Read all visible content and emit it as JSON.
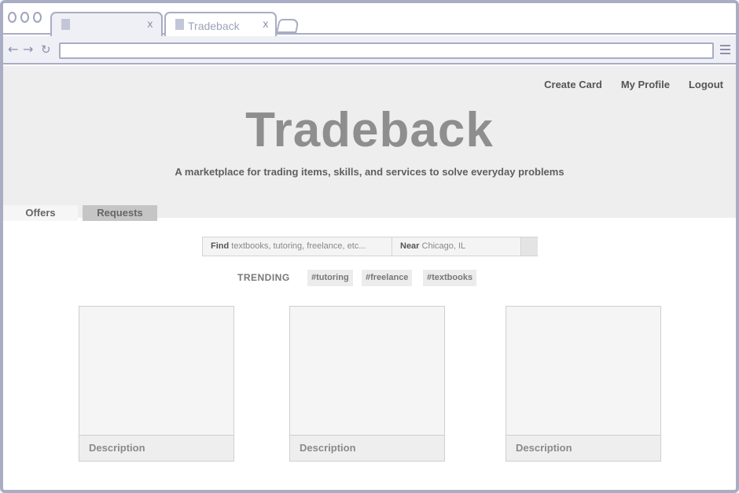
{
  "browser": {
    "tabs": [
      {
        "title": "",
        "close": "x"
      },
      {
        "title": "Tradeback",
        "close": "x"
      }
    ],
    "url": ""
  },
  "header": {
    "links": [
      "Create Card",
      "My Profile",
      "Logout"
    ],
    "brand": "Tradeback",
    "tagline": "A marketplace for trading items, skills, and services to solve everyday problems"
  },
  "mode_tabs": {
    "offers": "Offers",
    "requests": "Requests"
  },
  "search": {
    "find_label": "Find",
    "find_placeholder": "textbooks, tutoring, freelance, etc...",
    "near_label": "Near",
    "near_value": "Chicago, IL"
  },
  "trending": {
    "label": "TRENDING",
    "tags": [
      "#tutoring",
      "#freelance",
      "#textbooks"
    ]
  },
  "cards": [
    {
      "description": "Description"
    },
    {
      "description": "Description"
    },
    {
      "description": "Description"
    }
  ]
}
